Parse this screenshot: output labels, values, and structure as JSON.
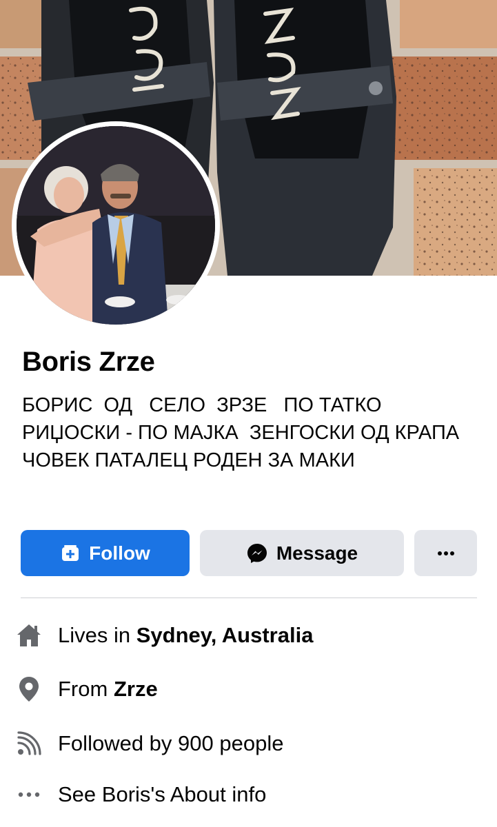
{
  "profile": {
    "name": "Boris Zrze",
    "bio": "БОРИС  ОД   СЕЛО  ЗРЗЕ   ПО ТАТКО РИЏОСКИ - ПО МАЈКА  ЗЕНГОСКИ ОД КРАПА ЧОВЕК ПАТАЛЕЦ РОДЕН ЗА МАКИ"
  },
  "cover": {
    "shoe_writing_left": "ЗРЗ",
    "shoe_writing_right": "ZRZ"
  },
  "actions": {
    "follow_label": "Follow",
    "message_label": "Message",
    "more_label": "···"
  },
  "colors": {
    "primary": "#1b74e4",
    "secondary_button": "#e4e6eb",
    "icon_gray": "#65676b"
  },
  "intro": {
    "lives_prefix": "Lives in ",
    "lives_value": "Sydney, Australia",
    "from_prefix": "From ",
    "from_value": "Zrze",
    "followers_text": "Followed by 900 people",
    "about_text": "See Boris's About info"
  },
  "icons": {
    "lives": "home-icon",
    "from": "location-pin-icon",
    "followers": "rss-feed-icon",
    "about": "ellipsis-icon"
  }
}
